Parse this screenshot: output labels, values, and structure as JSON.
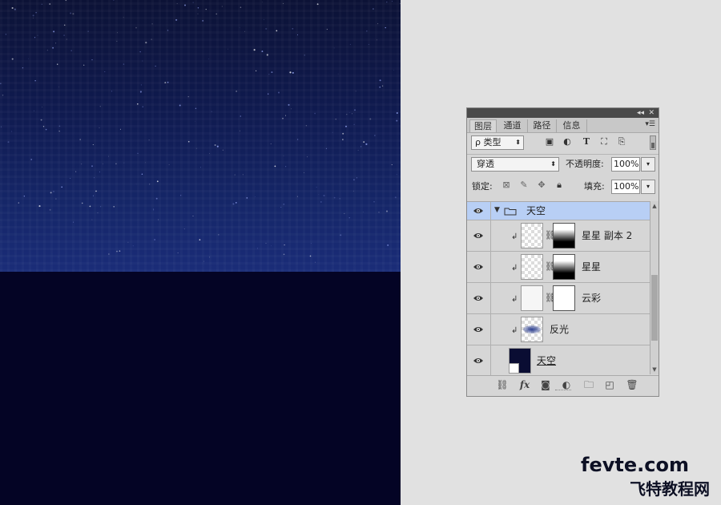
{
  "canvas": {
    "sky_color": "#152668",
    "ground_color": "#040425"
  },
  "panel": {
    "tabs": [
      "图层",
      "通道",
      "路径",
      "信息"
    ],
    "active_tab": 0,
    "filter": {
      "label": "ρ 类型"
    },
    "blend_mode": "穿透",
    "opacity_label": "不透明度:",
    "opacity_value": "100%",
    "lock_label": "锁定:",
    "fill_label": "填充:",
    "fill_value": "100%",
    "layers": [
      {
        "name": "天空",
        "type": "group",
        "expanded": true,
        "visible": true
      },
      {
        "name": "星星 副本 2",
        "type": "layer",
        "clipped": true,
        "mask": "white-top-black-bottom",
        "visible": true
      },
      {
        "name": "星星",
        "type": "layer",
        "clipped": true,
        "mask": "white-top-black-bottom",
        "visible": true
      },
      {
        "name": "云彩",
        "type": "layer",
        "clipped": true,
        "mask": "white",
        "visible": true
      },
      {
        "name": "反光",
        "type": "layer",
        "clipped": true,
        "visible": true
      },
      {
        "name": "天空",
        "type": "layer",
        "underlined": true,
        "visible": true
      }
    ],
    "icons": {
      "filter": [
        "image-icon",
        "adjustment-icon",
        "type-icon",
        "shape-icon",
        "smart-object-icon"
      ],
      "lock": [
        "lock-transparent-icon",
        "lock-paint-icon",
        "lock-move-icon",
        "lock-all-icon"
      ],
      "bottom": [
        "link-icon",
        "fx-icon",
        "mask-icon",
        "adjustment-icon",
        "folder-icon",
        "new-layer-icon",
        "trash-icon"
      ]
    }
  },
  "watermark": {
    "line1": "fevte.com",
    "line2": "飞特教程网"
  }
}
